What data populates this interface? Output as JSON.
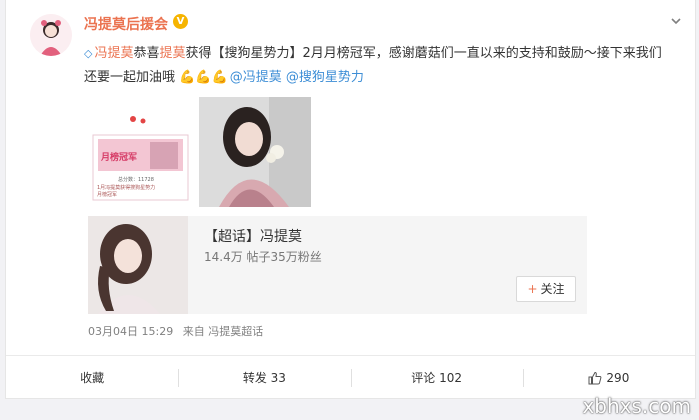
{
  "post": {
    "username": "冯提莫后援会",
    "verified_badge": "V",
    "text": {
      "prefix_link": "冯提莫",
      "congrats": "恭喜",
      "name_link": "提莫",
      "body": "获得【搜狗星势力】2月月榜冠军，感谢蘑菇们一直以来的支持和鼓励～接下来我们还要一起加油哦",
      "emoji": "💪💪💪",
      "mention1": "@冯提莫",
      "mention2": "@搜狗星势力"
    }
  },
  "thumbnail1": {
    "banner": "月榜冠军",
    "line1": "总分数：11728",
    "line2": "1月冯提莫获得搜狗星势力",
    "line3": "月榜冠军"
  },
  "supertopic": {
    "title": "【超话】冯提莫",
    "stats": "14.4万 帖子35万粉丝",
    "follow_label": "关注"
  },
  "meta": {
    "date": "03月04日 15:29",
    "source": "来自 冯提莫超话"
  },
  "footer": {
    "favorite": "收藏",
    "repost": "转发 33",
    "comment": "评论 102",
    "like": "290"
  },
  "watermark": "xbhxs.com",
  "colors": {
    "accent": "#eb7350",
    "mention": "#3d8ed6",
    "verified": "#f6b400"
  }
}
